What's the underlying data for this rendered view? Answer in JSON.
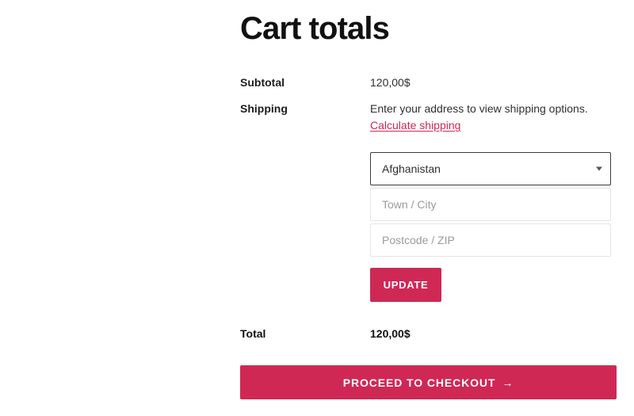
{
  "page": {
    "title": "Cart totals"
  },
  "totals": {
    "rows": [
      {
        "label": "Subtotal",
        "value": "120,00$"
      },
      {
        "label": "Shipping",
        "value": "Enter your address to view shipping options."
      },
      {
        "label": "Total",
        "value": "120,00$"
      }
    ],
    "shipping": {
      "note": "Enter your address to view shipping options.",
      "calculate_link": "Calculate shipping"
    }
  },
  "shipping_form": {
    "country": {
      "selected": "Afghanistan",
      "caret_icon": "chevron-down-icon"
    },
    "city": {
      "value": "",
      "placeholder": "Town / City"
    },
    "postcode": {
      "value": "",
      "placeholder": "Postcode / ZIP"
    },
    "update_label": "Update"
  },
  "checkout": {
    "label": "Proceed to checkout",
    "arrow_icon": "→"
  },
  "colors": {
    "accent": "#cf2855",
    "text": "#2f2f2f",
    "heading": "#111111",
    "placeholder": "#9b9b9b",
    "field_border": "#e4e4e4",
    "select_border": "#3a3a3a"
  }
}
